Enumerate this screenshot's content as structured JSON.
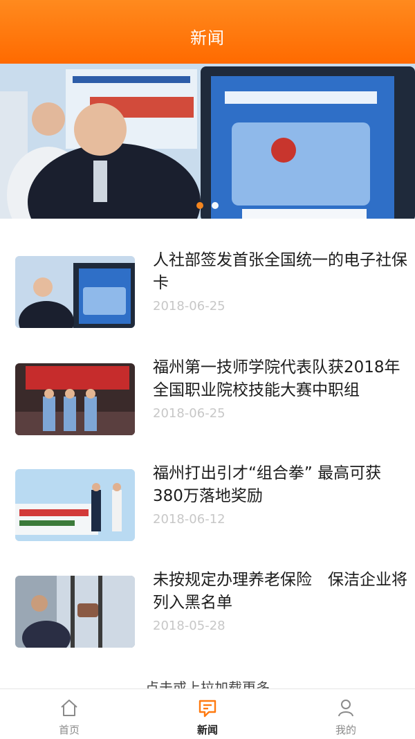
{
  "header": {
    "title": "新闻"
  },
  "banner": {
    "slides": 2,
    "active_index": 0
  },
  "news": [
    {
      "title": "人社部签发首张全国统一的电子社保卡",
      "date": "2018-06-25"
    },
    {
      "title": "福州第一技师学院代表队获2018年全国职业院校技能大赛中职组",
      "date": "2018-06-25"
    },
    {
      "title": "福州打出引才“组合拳” 最高可获380万落地奖励",
      "date": "2018-06-12"
    },
    {
      "title": "未按规定办理养老保险　保洁企业将列入黑名单",
      "date": "2018-05-28"
    }
  ],
  "load_more": "点击或上拉加载更多",
  "tabbar": {
    "items": [
      {
        "label": "首页",
        "icon": "home-icon"
      },
      {
        "label": "新闻",
        "icon": "news-chat-icon"
      },
      {
        "label": "我的",
        "icon": "user-icon"
      }
    ],
    "active": 1
  },
  "colors": {
    "accent": "#ff7a10",
    "date_gray": "#c7c7c7"
  }
}
